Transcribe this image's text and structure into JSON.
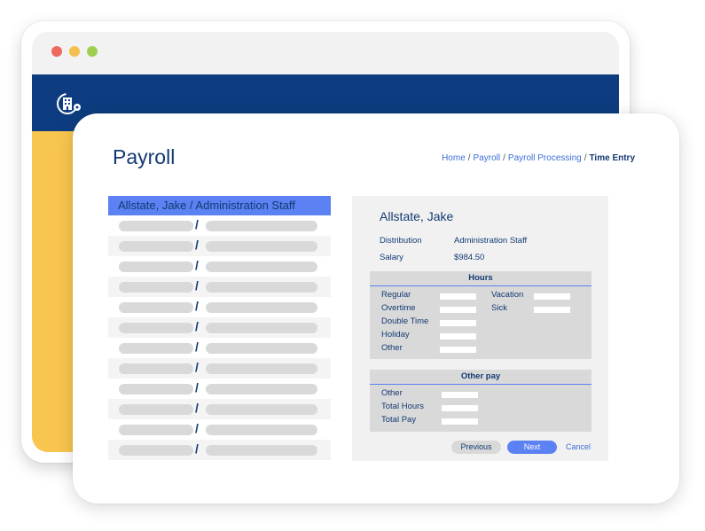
{
  "window": {
    "controls": [
      "close",
      "minimize",
      "maximize"
    ],
    "logo_icon": "building-gear-icon"
  },
  "page": {
    "title": "Payroll",
    "breadcrumb": [
      "Home",
      "Payroll",
      "Payroll Processing",
      "Time Entry"
    ]
  },
  "employee_list": {
    "selected": "Allstate, Jake / Administration Staff",
    "placeholder_rows": 12
  },
  "detail": {
    "name": "Allstate, Jake",
    "distribution_label": "Distribution",
    "distribution_value": "Administration Staff",
    "salary_label": "Salary",
    "salary_value": "$984.50",
    "hours": {
      "title": "Hours",
      "regular": "Regular",
      "overtime": "Overtime",
      "double_time": "Double Time",
      "holiday": "Holiday",
      "other": "Other",
      "vacation": "Vacation",
      "sick": "Sick"
    },
    "other_pay": {
      "title": "Other pay",
      "other": "Other",
      "total_hours": "Total Hours",
      "total_pay": "Total Pay"
    },
    "buttons": {
      "previous": "Previous",
      "next": "Next",
      "cancel": "Cancel"
    }
  },
  "colors": {
    "navy": "#0d3d80",
    "accent_blue": "#5b81f2",
    "yellow": "#f8c54e",
    "text_dark": "#123a73"
  }
}
